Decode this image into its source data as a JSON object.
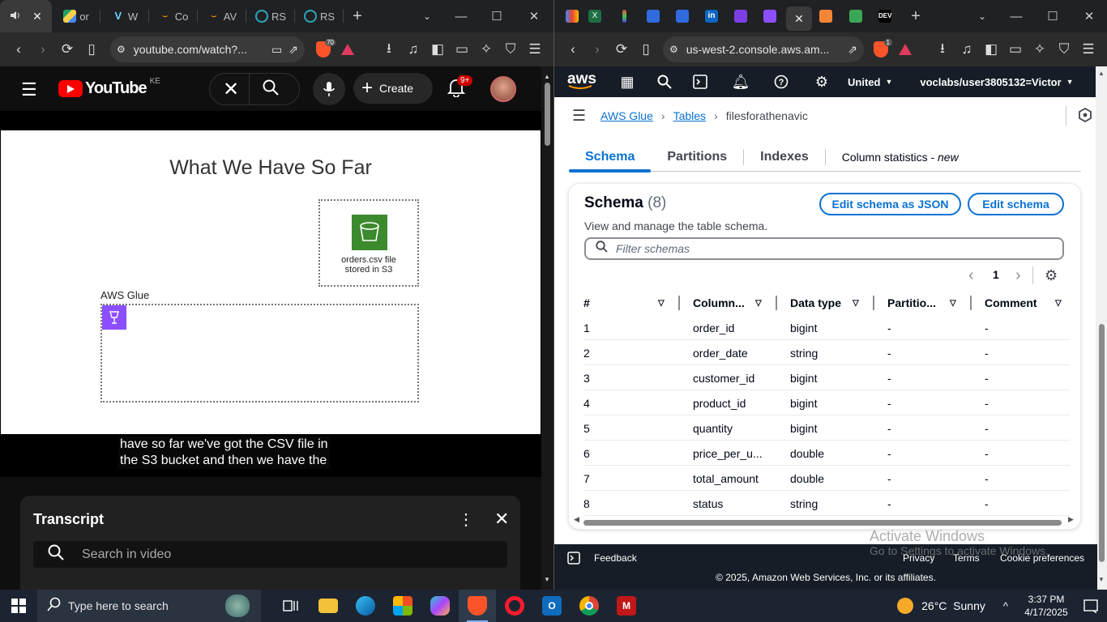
{
  "left_browser": {
    "tabs": [
      {
        "label": "",
        "icon": "speaker-icon"
      },
      {
        "label": "or",
        "icon": "drive-icon"
      },
      {
        "label": "W",
        "icon": "v-icon"
      },
      {
        "label": "Co",
        "icon": "amazon-icon"
      },
      {
        "label": "AV",
        "icon": "amazon-icon"
      },
      {
        "label": "RS",
        "icon": "rs-icon"
      },
      {
        "label": "RS",
        "icon": "rs-icon"
      }
    ],
    "url": "youtube.com/watch?...",
    "shield_badge": "70"
  },
  "youtube": {
    "logo": "YouTube",
    "region": "KE",
    "create_label": "Create",
    "notif_count": "9+",
    "slide": {
      "title": "What We Have So Far",
      "s3_caption_1": "orders.csv file",
      "s3_caption_2": "stored in S3",
      "glue_label": "AWS Glue"
    },
    "caption_lines": [
      "have so far we've got the CSV file in",
      "the S3 bucket and then we have the"
    ],
    "transcript": {
      "title": "Transcript",
      "search_placeholder": "Search in video"
    }
  },
  "right_browser": {
    "tabs": [
      {
        "icon": "gmail-icon"
      },
      {
        "icon": "excel-icon"
      },
      {
        "icon": "dev-icon"
      },
      {
        "icon": "blue-icon"
      },
      {
        "icon": "blue-icon"
      },
      {
        "icon": "linkedin-icon"
      },
      {
        "icon": "purple-icon"
      },
      {
        "icon": "purple-icon"
      },
      {
        "icon": "active-tab"
      },
      {
        "icon": "aws-icon"
      },
      {
        "icon": "green-icon"
      },
      {
        "icon": "dev-icon"
      }
    ],
    "url": "us-west-2.console.aws.am...",
    "shield_badge": "1"
  },
  "aws": {
    "logo": "aws",
    "region": "United",
    "user": "voclabs/user3805132=Victor",
    "breadcrumbs": [
      "AWS Glue",
      "Tables",
      "filesforathenavic"
    ],
    "tabs": [
      {
        "label": "Schema"
      },
      {
        "label": "Partitions"
      },
      {
        "label": "Indexes"
      },
      {
        "label": "Column statistics - ",
        "suffix": "new"
      }
    ],
    "schema": {
      "title": "Schema",
      "count": "(8)",
      "description": "View and manage the table schema.",
      "edit_json": "Edit schema as JSON",
      "edit": "Edit schema",
      "filter_placeholder": "Filter schemas",
      "page": "1",
      "columns": [
        "#",
        "Column...",
        "Data type",
        "Partitio...",
        "Comment"
      ],
      "rows": [
        {
          "n": "1",
          "name": "order_id",
          "type": "bigint",
          "part": "-",
          "comment": "-"
        },
        {
          "n": "2",
          "name": "order_date",
          "type": "string",
          "part": "-",
          "comment": "-"
        },
        {
          "n": "3",
          "name": "customer_id",
          "type": "bigint",
          "part": "-",
          "comment": "-"
        },
        {
          "n": "4",
          "name": "product_id",
          "type": "bigint",
          "part": "-",
          "comment": "-"
        },
        {
          "n": "5",
          "name": "quantity",
          "type": "bigint",
          "part": "-",
          "comment": "-"
        },
        {
          "n": "6",
          "name": "price_per_u...",
          "type": "double",
          "part": "-",
          "comment": "-"
        },
        {
          "n": "7",
          "name": "total_amount",
          "type": "double",
          "part": "-",
          "comment": "-"
        },
        {
          "n": "8",
          "name": "status",
          "type": "string",
          "part": "-",
          "comment": "-"
        }
      ]
    },
    "footer": {
      "feedback": "Feedback",
      "privacy": "Privacy",
      "terms": "Terms",
      "cookies": "Cookie preferences",
      "copyright": "© 2025, Amazon Web Services, Inc. or its affiliates."
    },
    "watermark": {
      "line1": "Activate Windows",
      "line2": "Go to Settings to activate Windows."
    }
  },
  "taskbar": {
    "search_placeholder": "Type here to search",
    "weather": "26°C  Sunny",
    "time": "3:37 PM",
    "date": "4/17/2025"
  }
}
